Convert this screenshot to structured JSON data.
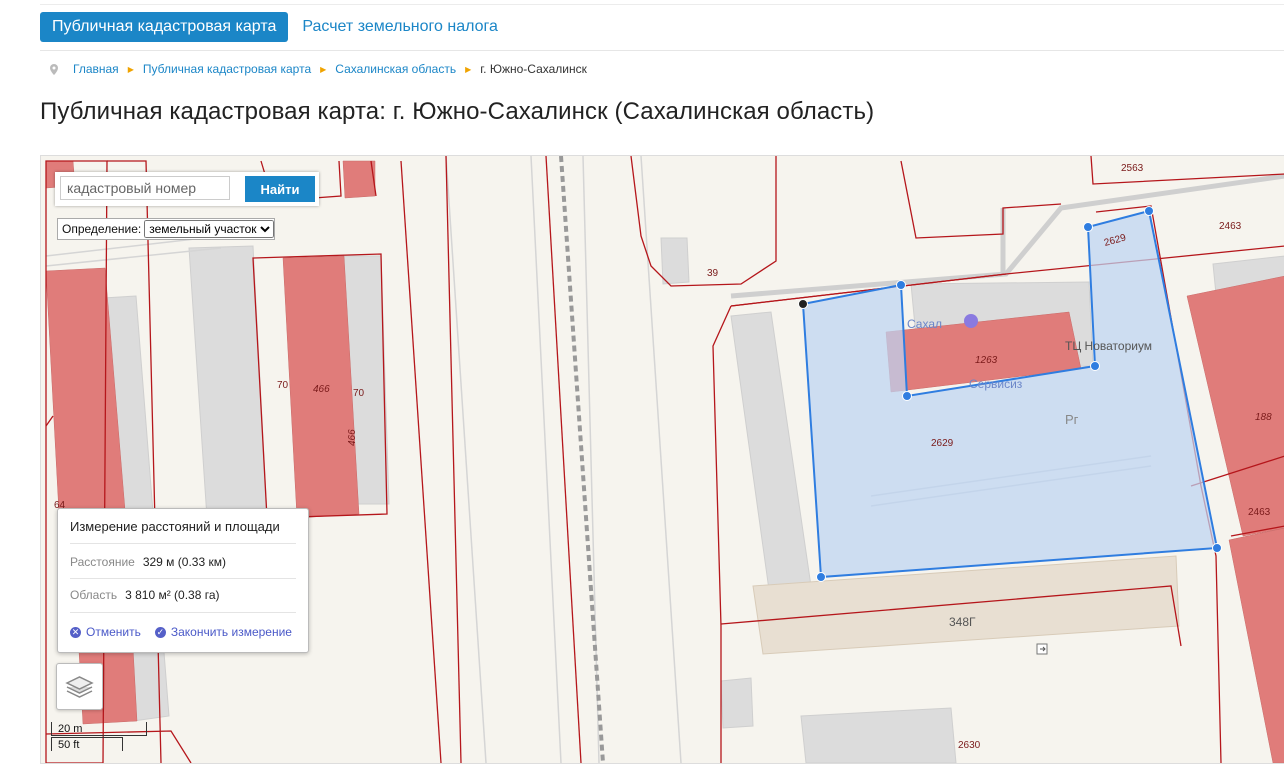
{
  "nav": {
    "active_tab": "Публичная кадастровая карта",
    "second_tab": "Расчет земельного налога"
  },
  "breadcrumbs": [
    "Главная",
    "Публичная кадастровая карта",
    "Сахалинская область"
  ],
  "breadcrumb_current": "г. Южно-Сахалинск",
  "page_title": "Публичная кадастровая карта: г. Южно-Сахалинск (Сахалинская область)",
  "search": {
    "placeholder": "кадастровый номер",
    "button": "Найти"
  },
  "definition": {
    "label": "Определение:",
    "selected": "земельный участок"
  },
  "measure": {
    "title": "Измерение расстояний и площади",
    "distance_label": "Расстояние",
    "distance_value": "329 м (0.33 км)",
    "area_label": "Область",
    "area_value": "3 810 м² (0.38 га)",
    "cancel": "Отменить",
    "finish": "Закончить измерение"
  },
  "scale": {
    "metric": "20 m",
    "imperial": "50 ft"
  },
  "map_labels": {
    "p2563": "2563",
    "p2463": "2463",
    "p2629a": "2629",
    "p39": "39",
    "poi_name": "ТЦ Новаториум",
    "poi_cut": "Сахал",
    "b1263": "1263",
    "poi2": "Сервисиз",
    "p2629": "2629",
    "pr": "Рг",
    "p70a": "70",
    "p466": "466",
    "p70b": "70",
    "p466v": "466",
    "p64": "64",
    "p188": "188",
    "p2463b": "2463",
    "b348g": "348Г",
    "p2630": "2630"
  },
  "colors": {
    "accent": "#1b86c7",
    "parcel_border": "#b5161b",
    "building": "#e07c7a",
    "measure_fill": "#bcd4f2",
    "measure_line": "#2f7de0"
  }
}
